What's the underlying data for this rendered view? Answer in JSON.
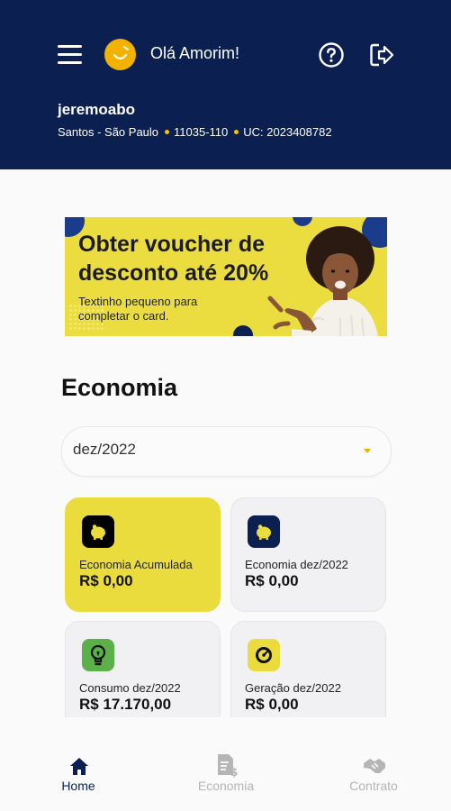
{
  "header": {
    "greeting": "Olá Amorim!",
    "username": "jeremoabo",
    "location": "Santos - São Paulo",
    "cep": "11035-110",
    "uc": "UC: 2023408782"
  },
  "banner": {
    "title": "Obter voucher de desconto até 20%",
    "subtitle": "Textinho pequeno para completar o card."
  },
  "economia": {
    "title": "Economia",
    "period": "dez/2022",
    "cards": [
      {
        "label": "Economia Acumulada",
        "value": "R$ 0,00"
      },
      {
        "label": "Economia dez/2022",
        "value": "R$ 0,00"
      },
      {
        "label": "Consumo dez/2022",
        "value": "R$ 17.170,00"
      },
      {
        "label": "Geração dez/2022",
        "value": "R$ 0,00"
      }
    ]
  },
  "nav": {
    "items": [
      {
        "label": "Home"
      },
      {
        "label": "Economia"
      },
      {
        "label": "Contrato"
      }
    ]
  },
  "colors": {
    "header_bg": "#0b2050",
    "accent_yellow": "#e9dc3c",
    "nav_active": "#0b2050",
    "nav_inactive": "#b5b5b5"
  }
}
